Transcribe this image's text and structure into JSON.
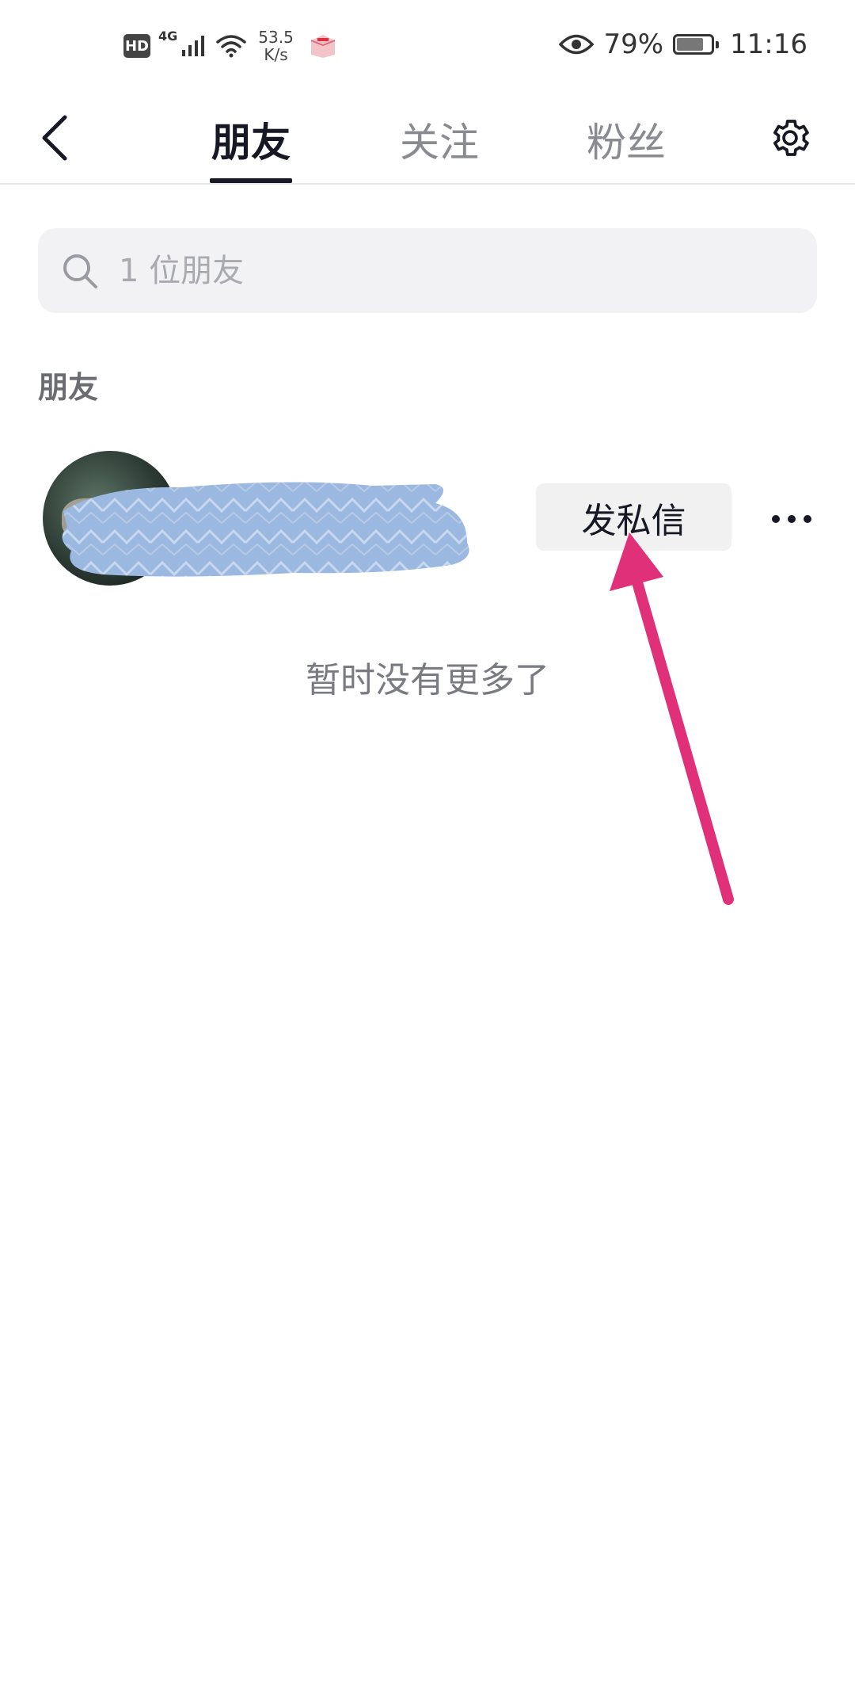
{
  "status_bar": {
    "hd": "HD",
    "network_type": "4G",
    "speed_value": "53.5",
    "speed_unit": "K/s",
    "battery_percent": "79%",
    "battery_level": 0.79,
    "time": "11:16"
  },
  "nav": {
    "tabs": [
      {
        "label": "朋友",
        "active": true
      },
      {
        "label": "关注",
        "active": false
      },
      {
        "label": "粉丝",
        "active": false
      }
    ]
  },
  "search": {
    "placeholder": "1 位朋友"
  },
  "section": {
    "title": "朋友"
  },
  "friend": {
    "dm_label": "发私信"
  },
  "footer": {
    "end_text": "暂时没有更多了"
  },
  "colors": {
    "annotation_arrow": "#e0307a",
    "redaction": "#9bb9e0",
    "text_primary": "#161823",
    "text_secondary": "#8a8b91"
  },
  "icons": {
    "back": "chevron-left-icon",
    "settings": "gear-icon",
    "search": "search-icon",
    "more": "more-horizontal-icon",
    "eye": "eye-icon",
    "wifi": "wifi-icon",
    "signal": "signal-icon",
    "battery": "battery-icon"
  }
}
